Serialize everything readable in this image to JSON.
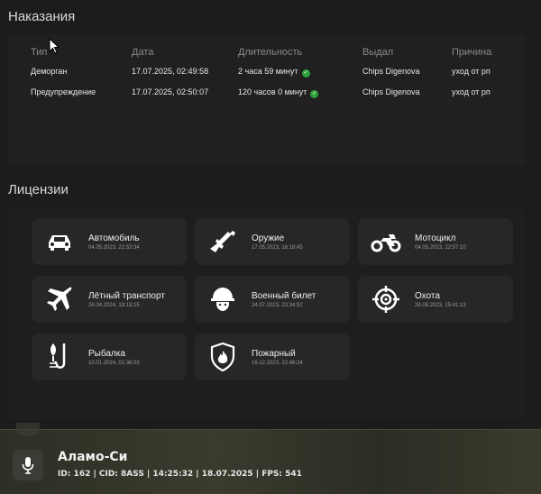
{
  "punishments": {
    "title": "Наказания",
    "headers": [
      "Тип",
      "Дата",
      "Длительность",
      "Выдал",
      "Причина"
    ],
    "rows": [
      {
        "type": "Деморган",
        "date": "17.07.2025, 02:49:58",
        "duration": "2 часа 59 минут",
        "issuer": "Chips Digenova",
        "reason": "уход от рп"
      },
      {
        "type": "Предупреждение",
        "date": "17.07.2025, 02:50:07",
        "duration": "120 часов 0 минут",
        "issuer": "Chips Digenova",
        "reason": "уход от рп"
      }
    ],
    "duration_icon": "check-circle-icon"
  },
  "licenses": {
    "title": "Лицензии",
    "items": [
      {
        "name": "Автомобиль",
        "date": "04.05.2023, 22:53:34",
        "icon": "car-icon"
      },
      {
        "name": "Оружие",
        "date": "17.05.2023, 16:18:45",
        "icon": "rifle-icon"
      },
      {
        "name": "Мотоцикл",
        "date": "04.05.2023, 22:57:10",
        "icon": "motorcycle-icon"
      },
      {
        "name": "Лётный транспорт",
        "date": "26.04.2024, 19:19:15",
        "icon": "airplane-icon"
      },
      {
        "name": "Военный билет",
        "date": "24.07.2023, 23:34:52",
        "icon": "soldier-helmet-icon"
      },
      {
        "name": "Охота",
        "date": "28.09.2023, 15:41:13",
        "icon": "crosshair-icon"
      },
      {
        "name": "Рыбалка",
        "date": "10.01.2024, 01:36:03",
        "icon": "fish-hook-icon"
      },
      {
        "name": "Пожарный",
        "date": "16.12.2023, 22:46:24",
        "icon": "fire-shield-icon"
      }
    ]
  },
  "hud": {
    "location": "Аламо-Си",
    "status_line": "ID: 162 | CID: 8ASS | 14:25:32  | 18.07.2025 | FPS: 541",
    "mic_icon": "microphone-icon"
  },
  "colors": {
    "background": "#1c1c1c",
    "card": "#272727",
    "ok_green": "#2fa33a"
  }
}
